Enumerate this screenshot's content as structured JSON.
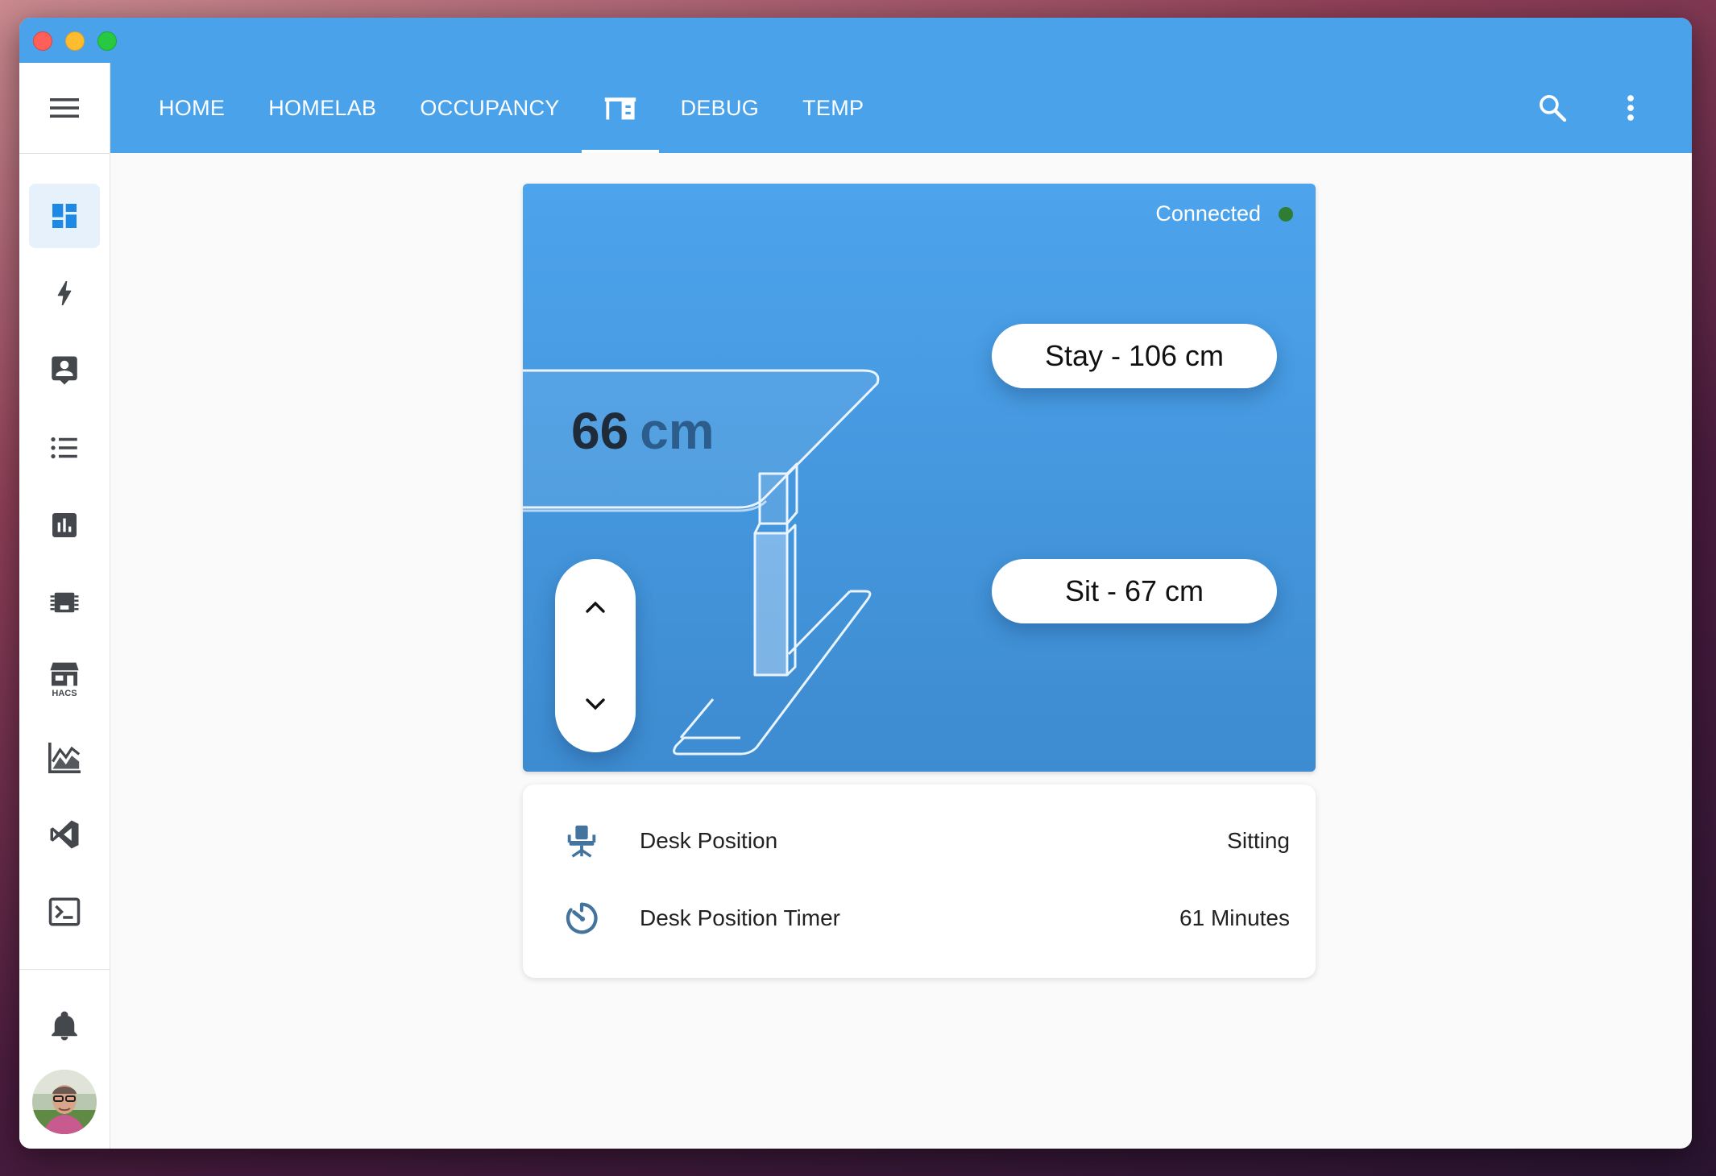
{
  "window": {
    "title": ""
  },
  "nav": {
    "tabs": [
      {
        "label": "HOME"
      },
      {
        "label": "HOMELAB"
      },
      {
        "label": "OCCUPANCY"
      },
      {
        "label": "",
        "icon": "desk-icon",
        "active": true
      },
      {
        "label": "DEBUG"
      },
      {
        "label": "TEMP"
      }
    ],
    "actions": [
      "search-icon",
      "more-vert-icon"
    ]
  },
  "sidebar": {
    "items": [
      {
        "icon": "dashboard-icon",
        "active": true
      },
      {
        "icon": "lightning-icon"
      },
      {
        "icon": "account-box-icon"
      },
      {
        "icon": "list-icon"
      },
      {
        "icon": "chart-icon"
      },
      {
        "icon": "chip-icon"
      },
      {
        "icon": "hacs-store-icon",
        "text": "HACS"
      },
      {
        "icon": "area-chart-icon"
      },
      {
        "icon": "vscode-icon"
      },
      {
        "icon": "terminal-icon"
      }
    ],
    "bottom": [
      "bell-icon",
      "avatar"
    ]
  },
  "desk": {
    "status": "Connected",
    "status_color": "#2e7d32",
    "height_value": "66",
    "height_unit": "cm",
    "presets": [
      {
        "label": "Stay - 106 cm"
      },
      {
        "label": "Sit - 67 cm"
      }
    ]
  },
  "entities": [
    {
      "icon": "desk-chair-icon",
      "label": "Desk Position",
      "value": "Sitting"
    },
    {
      "icon": "timer-icon",
      "label": "Desk Position Timer",
      "value": "61 Minutes"
    }
  ],
  "colors": {
    "primary": "#4aa3ea",
    "icon_gray": "#44474b",
    "entity_icon": "#44739e"
  }
}
